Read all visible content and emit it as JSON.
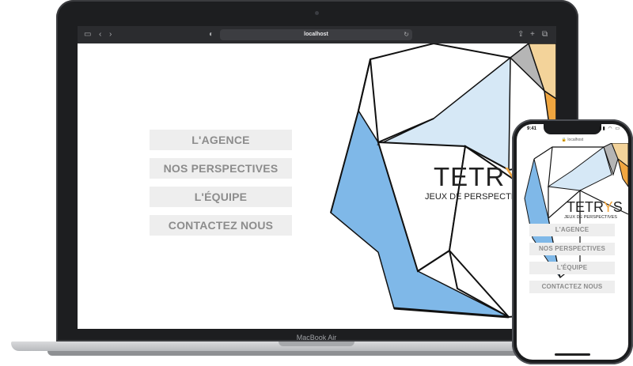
{
  "laptop": {
    "url": "localhost",
    "model_label": "MacBook Air"
  },
  "phone": {
    "time": "9:41",
    "url": "🔒 localhost"
  },
  "brand": {
    "name": "TETRYS",
    "tagline": "JEUX DE PERSPECTIVES"
  },
  "menu": [
    "L'AGENCE",
    "NOS PERSPECTIVES",
    "L'ÉQUIPE",
    "CONTACTEZ NOUS"
  ],
  "colors": {
    "blue": "#7fb8e8",
    "light_blue": "#d6e8f6",
    "orange": "#f0a640",
    "sand": "#f3d39a",
    "gray": "#b5b5b5",
    "button_bg": "#eeeeee",
    "button_text": "#8c8c8c"
  }
}
